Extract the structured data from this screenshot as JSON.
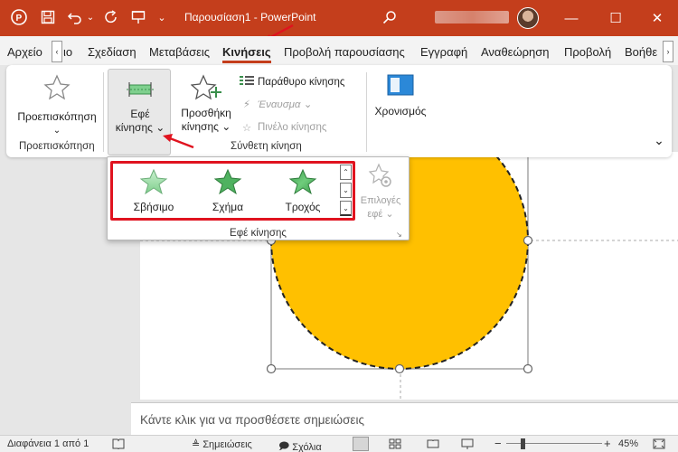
{
  "titlebar": {
    "title": "Παρουσίαση1 - PowerPoint",
    "app_icon": "powerpoint-logo",
    "save_icon": "save-icon",
    "undo_icon": "undo-icon",
    "redo_icon": "redo-icon",
    "present_icon": "present-from-start-icon",
    "customize_icon": "customize-qat-icon",
    "search_icon": "search-icon",
    "minimize": "—",
    "maximize": "☐",
    "close": "✕",
    "color": "#c43e1c"
  },
  "tabs": [
    {
      "label": "Αρχείο"
    },
    {
      "label": "ιο"
    },
    {
      "label": "Σχεδίαση"
    },
    {
      "label": "Μεταβάσεις"
    },
    {
      "label": "Κινήσεις"
    },
    {
      "label": "Προβολή παρουσίασης"
    },
    {
      "label": "Εγγραφή"
    },
    {
      "label": "Αναθεώρηση"
    },
    {
      "label": "Προβολή"
    },
    {
      "label": "Βοήθε"
    }
  ],
  "tab_scroll": {
    "left": "‹",
    "right": "›"
  },
  "ribbon": {
    "preview": {
      "label": "Προεπισκόπηση",
      "chevron": "⌄",
      "group_label": "Προεπισκόπηση"
    },
    "motion_effects": {
      "line1": "Εφέ",
      "line2": "κίνησης ⌄"
    },
    "add_motion": {
      "line1": "Προσθήκη",
      "line2": "κίνησης ⌄"
    },
    "motion_pane": "Παράθυρο κίνησης",
    "trigger": "Έναυσμα ⌄",
    "motion_brush": "Πινέλο κίνησης",
    "composite_group_label": "Σύνθετη κίνηση",
    "timing": "Χρονισμός",
    "collapse": "⌄"
  },
  "gallery": {
    "effects": [
      {
        "label": "Σβήσιμο"
      },
      {
        "label": "Σχήμα"
      },
      {
        "label": "Τροχός"
      }
    ],
    "options_line1": "Επιλογές",
    "options_line2": "εφέ ⌄",
    "footer_label": "Εφέ κίνησης",
    "scroll_up": "⌃",
    "scroll_down": "⌄",
    "more": "⌄"
  },
  "notes_placeholder": "Κάντε κλικ για να προσθέσετε σημειώσεις",
  "statusbar": {
    "slide_info": "Διαφάνεια 1 από 1",
    "notes": "Σημειώσεις",
    "comments": "Σχόλια",
    "zoom_minus": "−",
    "zoom_plus": "+",
    "zoom": "45%"
  },
  "colors": {
    "accent": "#c43e1c",
    "highlight_box": "#e0131f",
    "shape_fill": "#ffc000"
  }
}
